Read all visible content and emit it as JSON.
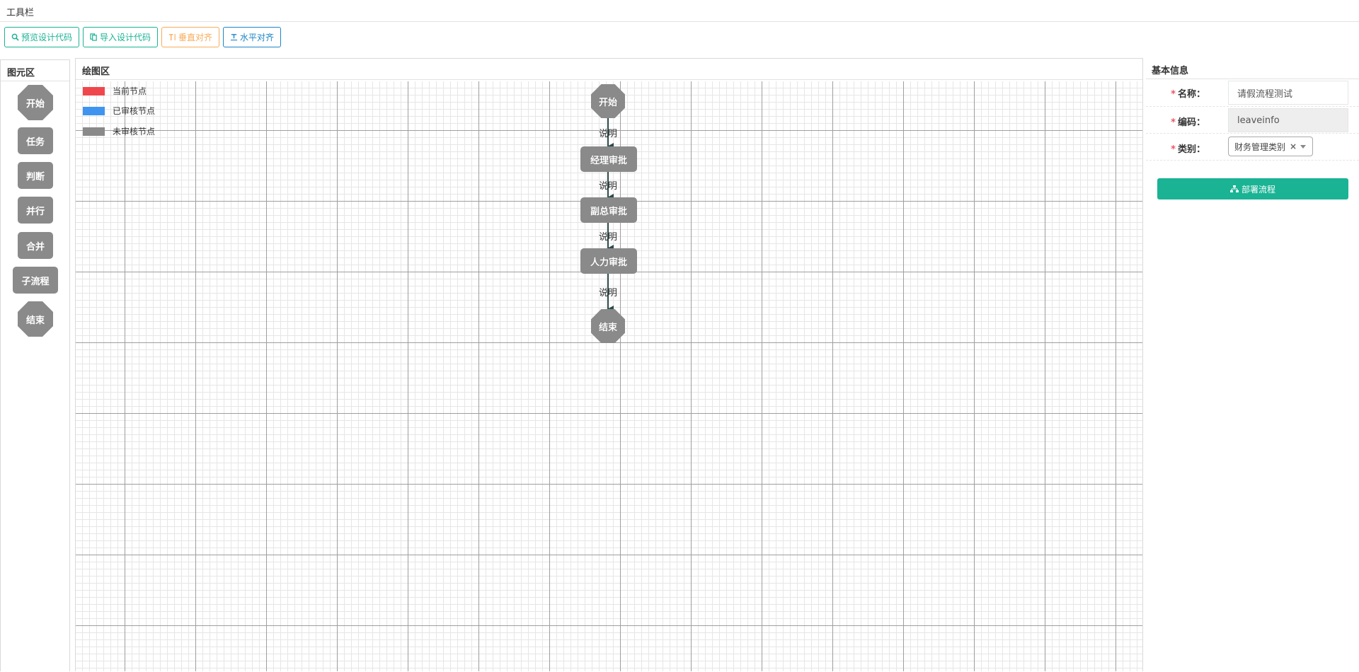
{
  "toolbar": {
    "title": "工具栏",
    "buttons": [
      {
        "label": "预览设计代码",
        "icon": "search-icon"
      },
      {
        "label": "导入设计代码",
        "icon": "copy-icon"
      },
      {
        "label": "垂直对齐",
        "icon": "text-height-icon"
      },
      {
        "label": "水平对齐",
        "icon": "text-width-icon"
      }
    ]
  },
  "palette": {
    "title": "图元区",
    "items": [
      "开始",
      "任务",
      "判断",
      "并行",
      "合并",
      "子流程",
      "结束"
    ]
  },
  "canvas": {
    "title": "绘图区",
    "legend": [
      {
        "label": "当前节点",
        "color": "#f0474c"
      },
      {
        "label": "已审核节点",
        "color": "#3f94f0"
      },
      {
        "label": "未审核节点",
        "color": "#8a8a8a"
      }
    ],
    "nodes": [
      "开始",
      "经理审批",
      "副总审批",
      "人力审批",
      "结束"
    ],
    "edge_labels": [
      "说明",
      "说明",
      "说明",
      "说明"
    ]
  },
  "info": {
    "title": "基本信息",
    "name_label": "名称：",
    "name_value": "请假流程测试",
    "code_label": "编码：",
    "code_value": "leaveinfo",
    "category_label": "类别：",
    "category_value": "财务管理类别",
    "category_clear": "×",
    "deploy_label": "部署流程"
  },
  "colors": {
    "primary": "#1ab394",
    "warning": "#f8ac59",
    "info": "#1c84c6",
    "node_gray": "#8a8a8a",
    "required": "#ed5565"
  }
}
